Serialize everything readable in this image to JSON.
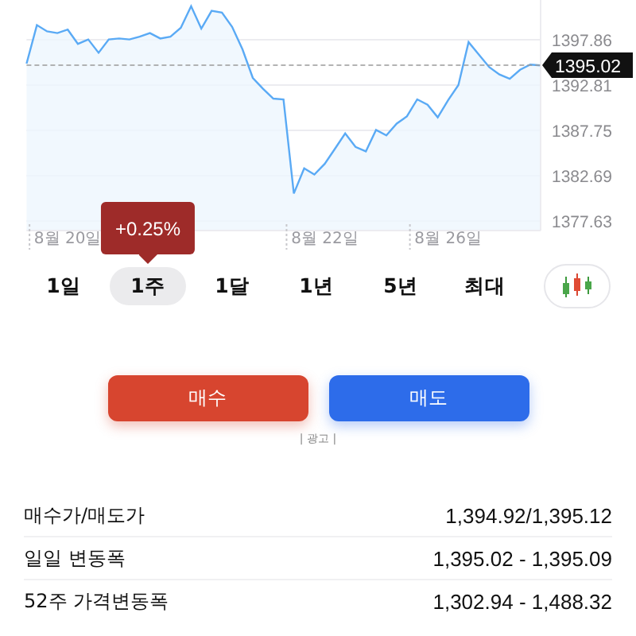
{
  "chart": {
    "current_price": "1395.02",
    "chart_data": {
      "type": "area",
      "grid": true,
      "categories": [
        null,
        null,
        null,
        null,
        "8월 20일",
        null,
        null,
        null,
        null,
        null,
        null,
        null,
        null,
        null,
        null,
        null,
        null,
        null,
        null,
        null,
        null,
        null,
        null,
        null,
        null,
        null,
        null,
        null,
        null,
        "8월 22일",
        null,
        null,
        null,
        null,
        null,
        null,
        null,
        null,
        null,
        null,
        null,
        "8월 26일",
        null,
        null,
        null,
        null,
        null,
        null,
        null,
        null,
        null
      ],
      "series": [
        {
          "color": "#5aaaf5",
          "values": [
            1395.2,
            1399.5,
            1398.8,
            1398.6,
            1399.0,
            1397.4,
            1397.9,
            1396.4,
            1397.9,
            1398.0,
            1397.9,
            1398.2,
            1398.6,
            1398.0,
            1398.2,
            1399.2,
            1401.6,
            1399.1,
            1401.1,
            1400.9,
            1399.3,
            1396.8,
            1393.6,
            1392.4,
            1391.3,
            1391.2,
            1380.7,
            1383.5,
            1382.8,
            1384.0,
            1385.7,
            1387.4,
            1385.9,
            1385.4,
            1387.8,
            1387.2,
            1388.5,
            1389.3,
            1391.2,
            1390.6,
            1389.2,
            1391.1,
            1392.8,
            1397.6,
            1396.2,
            1394.8,
            1394.0,
            1393.5,
            1394.5,
            1395.1,
            1395.0
          ]
        }
      ],
      "ylim": [
        1376.56,
        1402.3
      ],
      "yticks": [
        1397.86,
        1392.81,
        1387.75,
        1382.69,
        1377.63
      ]
    }
  },
  "tooltip": "+0.25%",
  "periods": [
    {
      "label": "1일",
      "selected": false
    },
    {
      "label": "1주",
      "selected": true
    },
    {
      "label": "1달",
      "selected": false
    },
    {
      "label": "1년",
      "selected": false
    },
    {
      "label": "5년",
      "selected": false
    },
    {
      "label": "최대",
      "selected": false
    }
  ],
  "actions": [
    {
      "label": "매수",
      "kind": "buy"
    },
    {
      "label": "매도",
      "kind": "sell"
    }
  ],
  "ad_label": "| 광고 |",
  "stats": [
    {
      "label": "매수가/매도가",
      "value": "1,394.92/1,395.12"
    },
    {
      "label": "일일 변동폭",
      "value": "1,395.02 - 1,395.09"
    },
    {
      "label": "52주 가격변동폭",
      "value": "1,302.94 - 1,488.32"
    }
  ]
}
